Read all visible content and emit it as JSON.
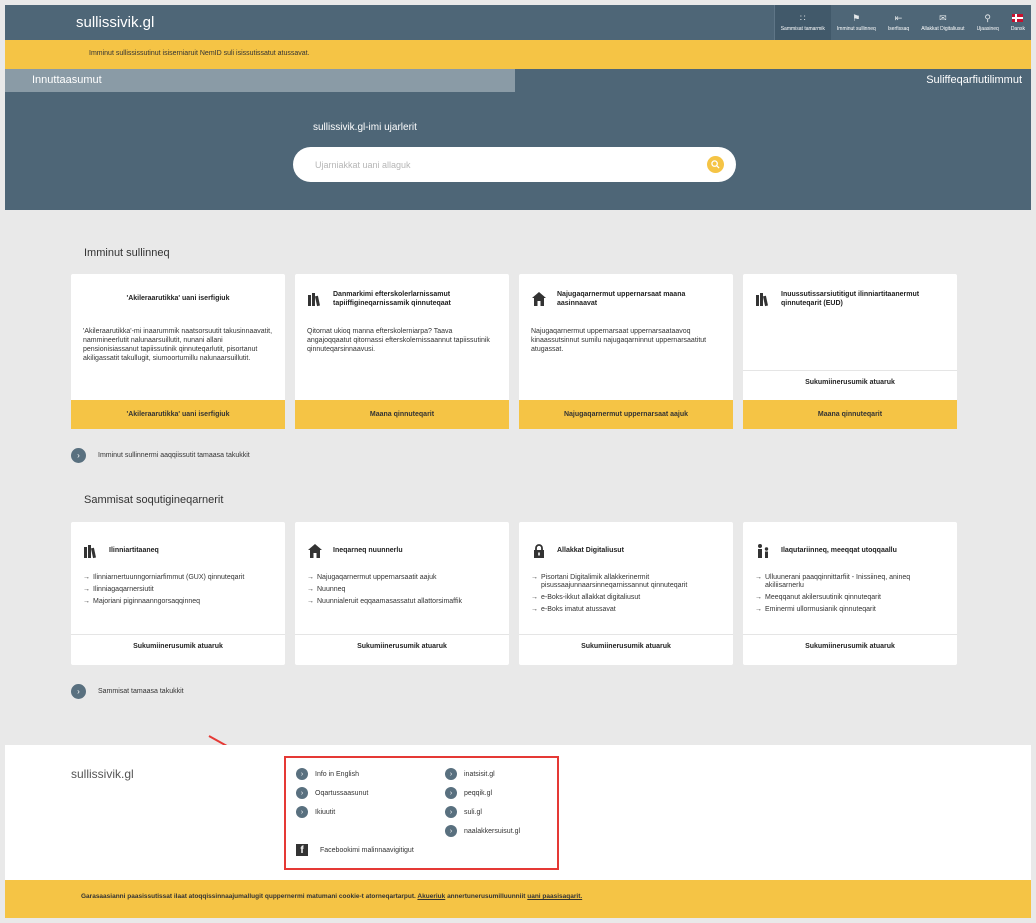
{
  "header": {
    "logo": "sullissivik.gl",
    "nav": [
      {
        "label": "Sammisat tamarmik",
        "icon": "grid-icon"
      },
      {
        "label": "Imminut sullinneq",
        "icon": "person-icon"
      },
      {
        "label": "Iserfissaq",
        "icon": "login-icon"
      },
      {
        "label": "Allakkat Digitaliusut",
        "icon": "mail-icon"
      },
      {
        "label": "Ujaasineq",
        "icon": "search-icon"
      },
      {
        "label": "Dansk",
        "icon": "danish-flag-icon"
      }
    ]
  },
  "notice": "Imminut sullississutinut isiserniaruit NemID suli isissutissatut atussavat.",
  "tabs": {
    "left": "Innuttaasumut",
    "right": "Suliffeqarfiutilimmut"
  },
  "hero": {
    "title": "sullissivik.gl-imi ujarlerit",
    "search_placeholder": "Ujarniakkat uani allaguk"
  },
  "self_service": {
    "title": "Imminut sullinneq",
    "cards": [
      {
        "title": "'Akileraarutikka' uani iserfigiuk",
        "text": "'Akileraarutikka'-mi inaarummik naatsorsuutit takusinnaavatit, nammineerlutit nalunaarsuillutit, nunani allani pensionisiassanut tapiissutinik qinnuteqarlutit, pisortanut akiligassatit takullugit, siumoortumillu nalunaarsuillutit.",
        "button": "'Akileraarutikka' uani iserfigiuk",
        "icon": "none"
      },
      {
        "title": "Danmarkimi efterskolerlarnissamut tapiiffigineqarnissamik qinnuteqaat",
        "text": "Qitornat ukioq manna efterskolerniarpa? Taava angajoqqaatut qitornassi efterskolernissaannut tapiissutinik qinnuteqarsinnaavusi.",
        "button": "Maana qinnuteqarit",
        "icon": "books-icon"
      },
      {
        "title": "Najugaqarnermut uppernarsaat maana aasinnaavat",
        "text": "Najugaqarnermut uppernarsaat uppernarsaataavoq kinaassutsinnut sumilu najugaqarninnut uppernarsaatitut atugassat.",
        "button": "Najugaqarnermut uppernarsaat aajuk",
        "icon": "house-icon"
      },
      {
        "title": "Inuussutissarsiutitigut ilinniartitaanermut qinnuteqarit (EUD)",
        "text": "",
        "link": "Sukumiinerusumik atuaruk",
        "button": "Maana qinnuteqarit",
        "icon": "books-icon"
      }
    ],
    "more": "Imminut sullinnermi aaqqiissutit tamaasa takukkit"
  },
  "services": {
    "title": "Sammisat soqutigineqarnerit",
    "cards": [
      {
        "title": "Ilinniartitaaneq",
        "icon": "books-icon",
        "items": [
          "Ilinniarnertuunngorniarfimmut (GUX) qinnuteqarit",
          "Ilinniagaqarnersiutit",
          "Majoriani piginnaanngorsaqqinneq"
        ],
        "link": "Sukumiinerusumik atuaruk"
      },
      {
        "title": "Ineqarneq nuunnerlu",
        "icon": "house-icon",
        "items": [
          "Najugaqarnermut uppernarsaatit aajuk",
          "Nuunneq",
          "Nuunnialeruit eqqaamasassatut allattorsimaffik"
        ],
        "link": "Sukumiinerusumik atuaruk"
      },
      {
        "title": "Allakkat Digitaliusut",
        "icon": "lock-icon",
        "items": [
          "Pisortani Digitalimik allakkerinermit pisussaajunnaarsinneqarnissannut qinnuteqarit",
          "e-Boks-ikkut allakkat digitaliusut",
          "e-Boks imatut atussavat"
        ],
        "link": "Sukumiinerusumik atuaruk"
      },
      {
        "title": "Ilaqutariinneq, meeqqat utoqqaallu",
        "icon": "family-icon",
        "items": [
          "Ulluunerani paaqqinnittarfiit - Inissiineq, anineq akiliisarnerlu",
          "Meeqqanut akilersuutinik qinnuteqarit",
          "Eminermi ullormusianik qinnuteqarit"
        ],
        "link": "Sukumiinerusumik atuaruk"
      }
    ],
    "more": "Sammisat tamaasa takukkit"
  },
  "footer": {
    "logo": "sullissivik.gl",
    "links_left": [
      "Info in English",
      "Oqartussaasunut",
      "Ikiuutit"
    ],
    "links_right": [
      "inatsisit.gl",
      "peqqik.gl",
      "suli.gl",
      "naalakkersuisut.gl"
    ],
    "facebook": "Facebookimi malinnaavigitigut"
  },
  "cookie": {
    "text": "Garasaasianni paasissutissat ilaat atoqqissinnaajumallugit quppernermi matumani cookie-t atorneqartarput.",
    "accept": "Akueriuk",
    "middle": "annertunerusumilluunniit",
    "more_link": "uani paasisaqarit."
  },
  "colors": {
    "header_bg": "#4e6677",
    "accent_yellow": "#f5c445",
    "annotation_red": "#e53935"
  }
}
